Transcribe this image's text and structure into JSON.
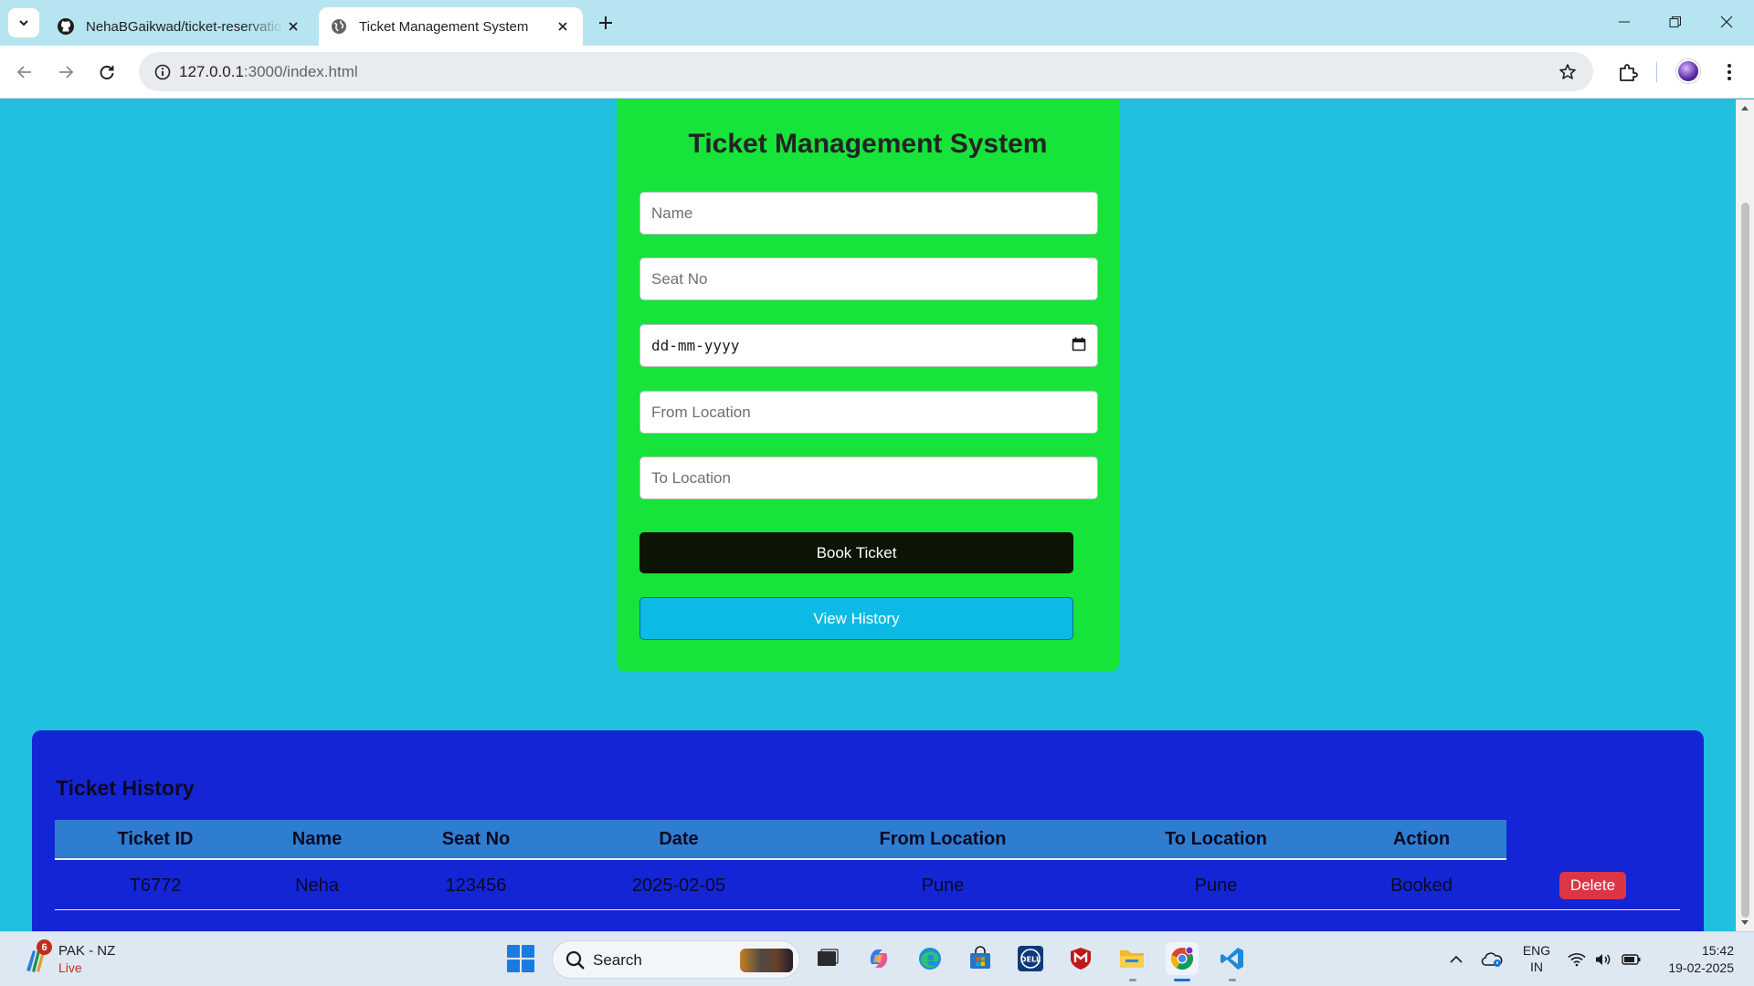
{
  "browser": {
    "tabs": [
      {
        "title": "NehaBGaikwad/ticket-reservatio",
        "icon": "github-icon",
        "active": false
      },
      {
        "title": "Ticket Management System",
        "icon": "globe-icon",
        "active": true
      }
    ],
    "url_host": "127.0.0.1",
    "url_path": ":3000/index.html"
  },
  "form": {
    "title": "Ticket Management System",
    "name_placeholder": "Name",
    "seat_placeholder": "Seat No",
    "date_placeholder": "dd-mm-yyyy",
    "from_placeholder": "From Location",
    "to_placeholder": "To Location",
    "book_button": "Book Ticket",
    "view_button": "View History"
  },
  "history": {
    "title": "Ticket History",
    "columns": [
      "Ticket ID",
      "Name",
      "Seat No",
      "Date",
      "From Location",
      "To Location",
      "Action"
    ],
    "rows": [
      {
        "ticket_id": "T6772",
        "name": "Neha",
        "seat_no": "123456",
        "date": "2025-02-05",
        "from": "Pune",
        "to": "Pune",
        "action": "Booked",
        "button": "Delete"
      }
    ]
  },
  "taskbar": {
    "weather_badge": "6",
    "weather_title": "PAK - NZ",
    "weather_status": "Live",
    "search_label": "Search",
    "lang_line1": "ENG",
    "lang_line2": "IN",
    "time": "15:42",
    "date": "19-02-2025"
  },
  "colors": {
    "page_bg": "#20bfdd",
    "card_bg": "#16e43a",
    "history_bg": "#1425d6",
    "table_header_bg": "#2e7dd0",
    "book_button_bg": "#0b1405",
    "view_button_bg": "#0bbbe6",
    "delete_button_bg": "#dc3545"
  }
}
